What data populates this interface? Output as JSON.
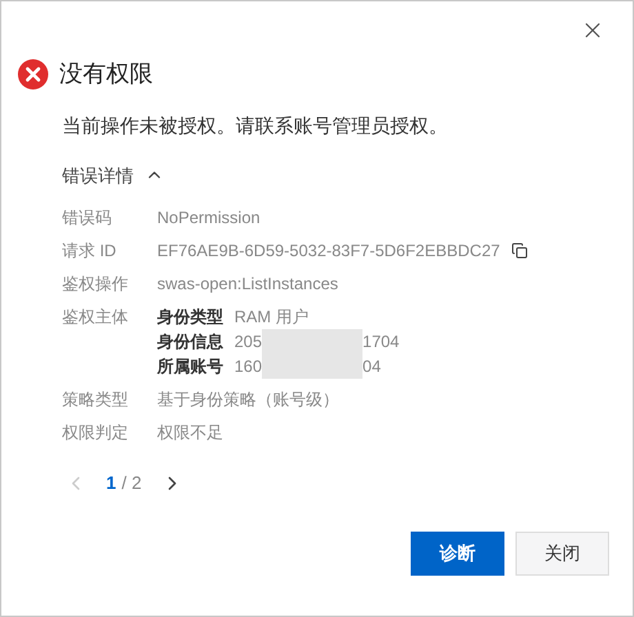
{
  "dialog": {
    "title": "没有权限",
    "message": "当前操作未被授权。请联系账号管理员授权。",
    "details": {
      "toggle": "错误详情",
      "expanded": true,
      "rows": [
        {
          "kind": "text",
          "label": "错误码",
          "value": "NoPermission"
        },
        {
          "kind": "copy",
          "label": "请求 ID",
          "value": "EF76AE9B-6D59-5032-83F7-5D6F2EBBDC27"
        },
        {
          "kind": "text",
          "label": "鉴权操作",
          "value": "swas-open:ListInstances"
        },
        {
          "kind": "group",
          "label": "鉴权主体",
          "items": [
            {
              "label": "身份类型",
              "parts": [
                "RAM 用户"
              ]
            },
            {
              "label": "身份信息",
              "parts": [
                "205",
                "1704"
              ]
            },
            {
              "label": "所属账号",
              "parts": [
                "160",
                "04"
              ]
            }
          ]
        },
        {
          "kind": "text",
          "label": "策略类型",
          "value": "基于身份策略（账号级）"
        },
        {
          "kind": "text",
          "label": "权限判定",
          "value": "权限不足"
        }
      ]
    },
    "pagination": {
      "current": "1",
      "total": "/ 2",
      "prev_disabled": true,
      "next_disabled": false
    },
    "buttons": [
      {
        "label": "诊断",
        "kind": "primary"
      },
      {
        "label": "关闭",
        "kind": "secondary"
      }
    ]
  }
}
